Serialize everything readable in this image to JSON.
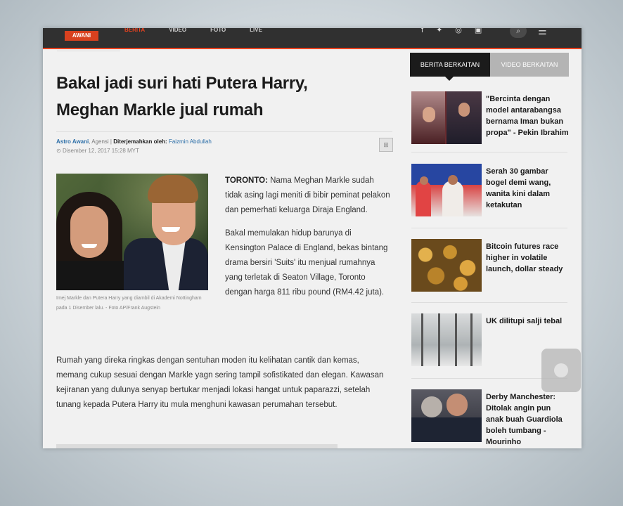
{
  "nav": {
    "logo": "AWANI",
    "items": [
      "BERITA",
      "VIDEO",
      "FOTO",
      "LIVE"
    ],
    "active_index": 0
  },
  "article": {
    "headline": "Bakal jadi suri hati Putera Harry, Meghan Markle jual rumah",
    "author": "Astro Awani",
    "agency": ", Agensi | ",
    "translated_label": "Diterjemahkan oleh:",
    "translator": "Faizmin Abdullah",
    "date": "Disember 12, 2017 15:28 MYT",
    "image_caption": "Imej Markle dan Putera Harry yang diambil di Akademi Nottingham pada 1 Disember lalu. - Foto AP/Frank Augstein",
    "lead_bold": "TORONTO:",
    "lead_paragraph_1": " Nama Meghan Markle sudah tidak asing lagi meniti di bibir peminat pelakon dan pemerhati keluarga Diraja England.",
    "lead_paragraph_2": "Bakal memulakan hidup barunya di Kensington Palace di England, bekas bintang drama bersiri 'Suits' itu  menjual rumahnya yang terletak di Seaton Village, Toronto dengan harga 811 ribu pound (RM4.42 juta).",
    "body_paragraph": "Rumah yang direka ringkas dengan sentuhan moden itu kelihatan cantik dan kemas, memang cukup sesuai dengan Markle yagn sering tampil sofistikated dan elegan. Kawasan kejiranan yang dulunya senyap bertukar menjadi lokasi hangat untuk paparazzi, setelah tunang kepada Putera Harry itu mula menghuni kawasan perumahan tersebut."
  },
  "sidebar": {
    "tab_active": "BERITA BERKAITAN",
    "tab_inactive": "VIDEO BERKAITAN",
    "related": [
      {
        "title": "\"Bercinta dengan model antarabangsa bernama Iman bukan propa\" - Pekin Ibrahim"
      },
      {
        "title": "Serah 30 gambar bogel demi wang, wanita kini dalam ketakutan"
      },
      {
        "title": "Bitcoin futures race higher in volatile launch, dollar steady"
      },
      {
        "title": "UK dilitupi salji tebal"
      },
      {
        "title": "Derby Manchester: Ditolak angin pun anak buah Guardiola boleh tumbang - Mourinho"
      }
    ]
  },
  "colors": {
    "accent": "#e8421f",
    "topbar": "#303030",
    "link": "#2d6fa8"
  },
  "icons": [
    "facebook-icon",
    "twitter-icon",
    "instagram-icon",
    "youtube-icon",
    "search-icon",
    "menu-icon",
    "share-icon"
  ]
}
